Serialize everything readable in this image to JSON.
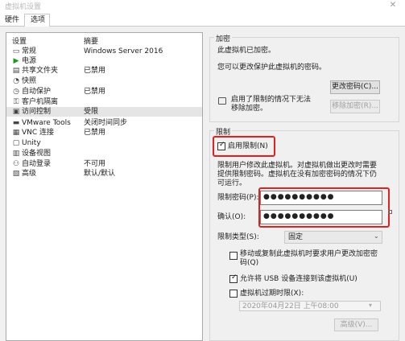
{
  "window": {
    "title": "虚拟机设置",
    "close_label": "✕"
  },
  "tabs": [
    {
      "label": "硬件"
    },
    {
      "label": "选项"
    }
  ],
  "list": {
    "header_setting": "设置",
    "header_summary": "摘要",
    "items": [
      {
        "name": "常规",
        "summary": "Windows Server 2016",
        "icon": "general-icon",
        "glyph": "▭"
      },
      {
        "name": "电源",
        "summary": "",
        "icon": "power-play-icon",
        "glyph": "▶"
      },
      {
        "name": "共享文件夹",
        "summary": "已禁用",
        "icon": "shared-folders-icon",
        "glyph": "▤"
      },
      {
        "name": "快照",
        "summary": "",
        "icon": "snapshot-icon",
        "glyph": "◔"
      },
      {
        "name": "自动保护",
        "summary": "已禁用",
        "icon": "autoprotect-icon",
        "glyph": "◷"
      },
      {
        "name": "客户机隔离",
        "summary": "",
        "icon": "guest-isolation-icon",
        "glyph": "⚿"
      },
      {
        "name": "访问控制",
        "summary": "受限",
        "icon": "access-control-icon",
        "glyph": "▣"
      },
      {
        "name": "VMware Tools",
        "summary": "关闭时间同步",
        "icon": "vmware-tools-icon",
        "glyph": "▬"
      },
      {
        "name": "VNC 连接",
        "summary": "已禁用",
        "icon": "vnc-icon",
        "glyph": "▦"
      },
      {
        "name": "Unity",
        "summary": "",
        "icon": "unity-icon",
        "glyph": "▢"
      },
      {
        "name": "设备视图",
        "summary": "",
        "icon": "device-view-icon",
        "glyph": "▥"
      },
      {
        "name": "自动登录",
        "summary": "不可用",
        "icon": "autologin-icon",
        "glyph": "⚇"
      },
      {
        "name": "高级",
        "summary": "默认/默认",
        "icon": "advanced-icon",
        "glyph": "▧"
      }
    ],
    "selected_index": 6
  },
  "encryption": {
    "group_title": "加密",
    "status_text": "此虚拟机已加密。",
    "change_desc": "您可以更改保护此虚拟机的密码。",
    "change_button": "更改密码(C)...",
    "note_text": "启用了限制的情况下无法移除加密。",
    "remove_button": "移除加密(R)...",
    "note_icon": "comment-icon"
  },
  "restrictions": {
    "group_title": "限制",
    "enable_label": "启用限制(N)",
    "enable_checked": true,
    "desc": "限制用户修改此虚拟机。对虚拟机做出更改时需要提供限制密码。虚拟机在没有加密密码的情况下仍可运行。",
    "password_label": "限制密码(P):",
    "password_value": "●●●●●●●●●●",
    "confirm_label": "确认(O):",
    "confirm_value": "●●●●●●●●●●",
    "type_label": "限制类型(S):",
    "type_value": "固定",
    "opt_change_pwd": "移动或复制此虚拟机时要求用户更改加密密码(Q)",
    "opt_usb": "允许将 USB 设备连接到该虚拟机(U)",
    "opt_usb_checked": true,
    "opt_expire": "虚拟机过期时限(X):",
    "expire_date": "2020年04月22日 上午08:00",
    "advanced_button": "高级(V)..."
  }
}
